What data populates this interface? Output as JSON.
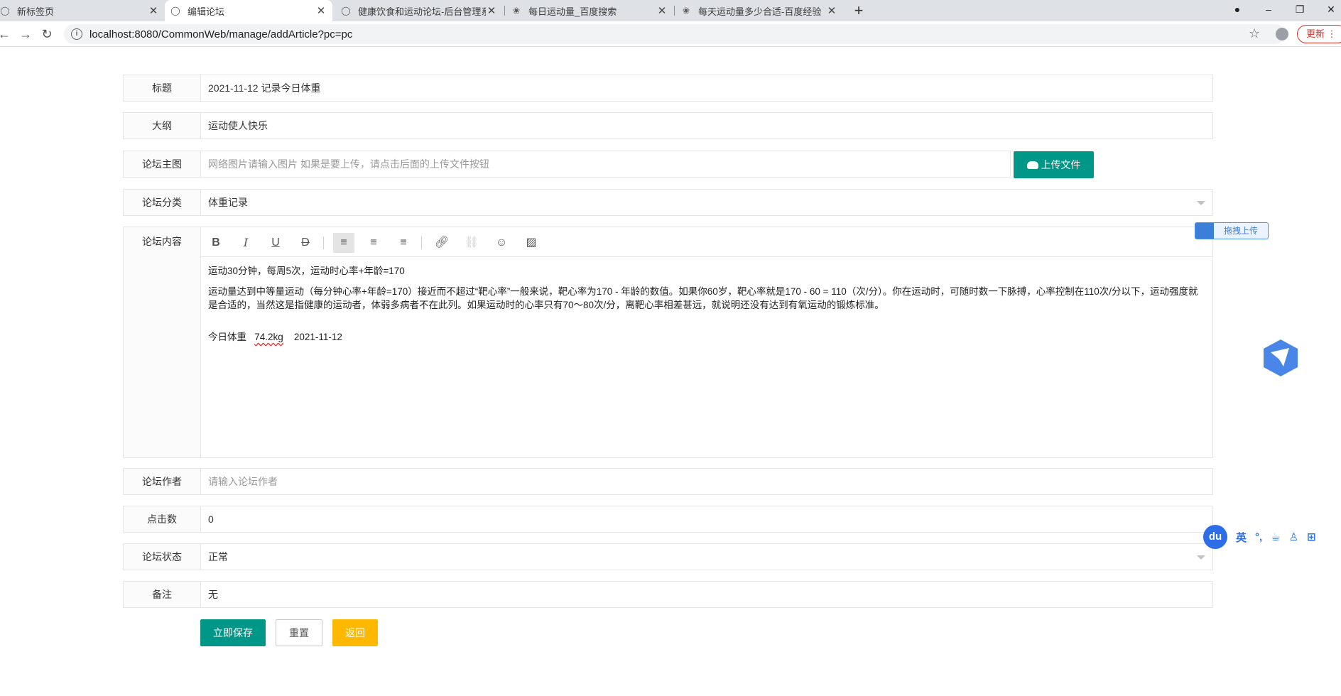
{
  "browser": {
    "tabs": [
      {
        "title": "新标签页",
        "active": false
      },
      {
        "title": "编辑论坛",
        "active": true
      },
      {
        "title": "健康饮食和运动论坛-后台管理系",
        "active": false
      },
      {
        "title": "每日运动量_百度搜索",
        "active": false
      },
      {
        "title": "每天运动量多少合适-百度经验",
        "active": false
      }
    ],
    "url": "localhost:8080/CommonWeb/manage/addArticle?pc=pc",
    "update_label": "更新"
  },
  "form": {
    "title": {
      "label": "标题",
      "value": "2021-11-12 记录今日体重"
    },
    "outline": {
      "label": "大纲",
      "value": "运动使人快乐"
    },
    "main_image": {
      "label": "论坛主图",
      "placeholder": "网络图片请输入图片 如果是要上传，请点击后面的上传文件按钮"
    },
    "upload_label": "上传文件",
    "category": {
      "label": "论坛分类",
      "value": "体重记录"
    },
    "content": {
      "label": "论坛内容",
      "line1": "运动30分钟，每周5次，运动时心率+年龄=170",
      "line2": "运动量达到中等量运动（每分钟心率+年龄=170）接近而不超过“靶心率”一般来说，靶心率为170 - 年龄的数值。如果你60岁，靶心率就是170 - 60 = 110（次/分）。你在运动时，可随时数一下脉搏，心率控制在110次/分以下，运动强度就是合适的，当然这是指健康的运动者，体弱多病者不在此列。如果运动时的心率只有70～80次/分，离靶心率相差甚远，就说明还没有达到有氧运动的锻炼标准。",
      "weight_prefix": "今日体重",
      "weight_value": "74.2kg",
      "weight_date": "2021-11-12"
    },
    "author": {
      "label": "论坛作者",
      "placeholder": "请输入论坛作者"
    },
    "clicks": {
      "label": "点击数",
      "value": "0"
    },
    "status": {
      "label": "论坛状态",
      "value": "正常"
    },
    "remark": {
      "label": "备注",
      "value": "无"
    },
    "buttons": {
      "save": "立即保存",
      "reset": "重置",
      "back": "返回"
    }
  },
  "widgets": {
    "drag_upload": "拖拽上传",
    "ime": {
      "logo": "du",
      "lang": "英"
    }
  },
  "colors": {
    "primary": "#009688",
    "warm": "#ffb800",
    "accent_blue": "#2d6ee8"
  }
}
